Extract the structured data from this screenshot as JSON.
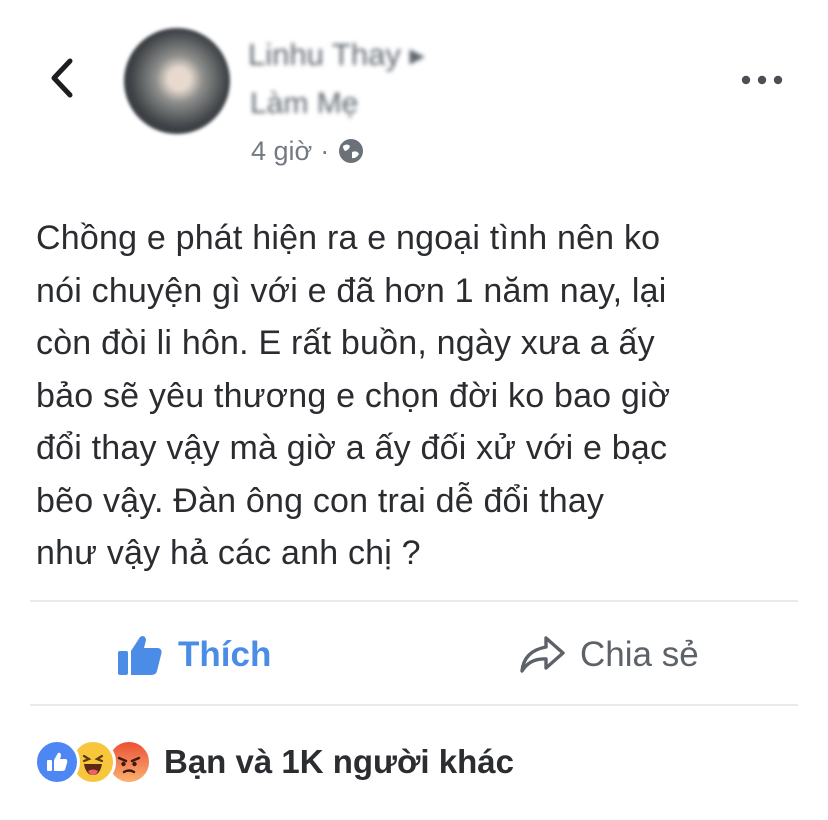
{
  "header": {
    "author_name": "Linhu Thay ▸",
    "group_name": "Làm Mẹ",
    "timestamp": "4 giờ",
    "separator": "·",
    "privacy_icon": "globe-icon",
    "back_icon": "chevron-left-icon",
    "more_icon": "ellipsis-icon"
  },
  "post": {
    "lines": [
      "Chồng e phát hiện ra e ngoại tình nên ko",
      "nói chuyện gì với e đã hơn 1 năm nay, lại",
      "còn đòi li hôn. E rất buồn, ngày xưa a ấy",
      "bảo sẽ yêu thương e chọn đời ko bao giờ",
      "đổi thay vậy mà giờ a ấy đối xử với e bạc",
      "bẽo vậy. Đàn ông con trai dễ đổi thay",
      "như vậy hả các anh chị ?"
    ]
  },
  "actions": {
    "like_label": "Thích",
    "like_icon": "thumbs-up-icon",
    "share_label": "Chia sẻ",
    "share_icon": "share-arrow-icon"
  },
  "reactions": {
    "icons": [
      "like-reaction-icon",
      "haha-reaction-icon",
      "angry-reaction-icon"
    ],
    "summary": "Bạn và 1K người khác"
  },
  "colors": {
    "accent_blue": "#4a8ce6",
    "text_dark": "#2a2c30",
    "text_muted": "#737a82",
    "divider": "#e8e9ec"
  }
}
